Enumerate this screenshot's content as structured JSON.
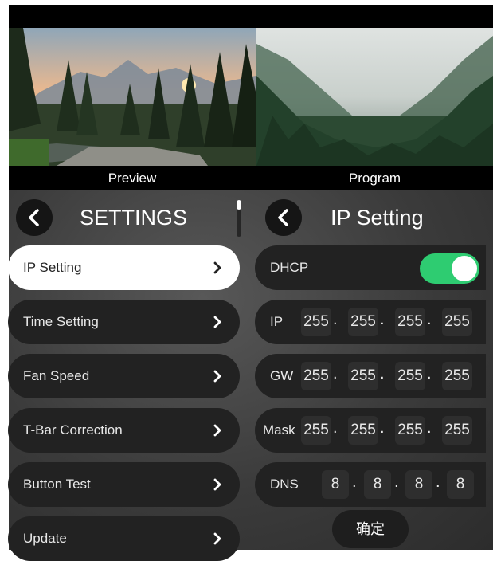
{
  "monitor": {
    "preview_label": "Preview",
    "program_label": "Program"
  },
  "settings": {
    "title": "SETTINGS",
    "items": [
      {
        "label": "IP Setting",
        "active": true
      },
      {
        "label": "Time Setting",
        "active": false
      },
      {
        "label": "Fan Speed",
        "active": false
      },
      {
        "label": "T-Bar Correction",
        "active": false
      },
      {
        "label": "Button Test",
        "active": false
      },
      {
        "label": "Update",
        "active": false
      }
    ]
  },
  "ip_setting": {
    "title": "IP Setting",
    "dhcp": {
      "label": "DHCP",
      "enabled": true
    },
    "ip": {
      "label": "IP",
      "octets": [
        "255",
        "255",
        "255",
        "255"
      ]
    },
    "gw": {
      "label": "GW",
      "octets": [
        "255",
        "255",
        "255",
        "255"
      ]
    },
    "mask": {
      "label": "Mask",
      "octets": [
        "255",
        "255",
        "255",
        "255"
      ]
    },
    "dns": {
      "label": "DNS",
      "octets": [
        "8",
        "8",
        "8",
        "8"
      ]
    },
    "confirm_label": "确定"
  },
  "colors": {
    "toggle_on": "#2ecc71",
    "row_bg": "#222222",
    "active_item_bg": "#ffffff"
  },
  "icons": {
    "back": "chevron-left-icon",
    "item": "chevron-right-icon"
  }
}
